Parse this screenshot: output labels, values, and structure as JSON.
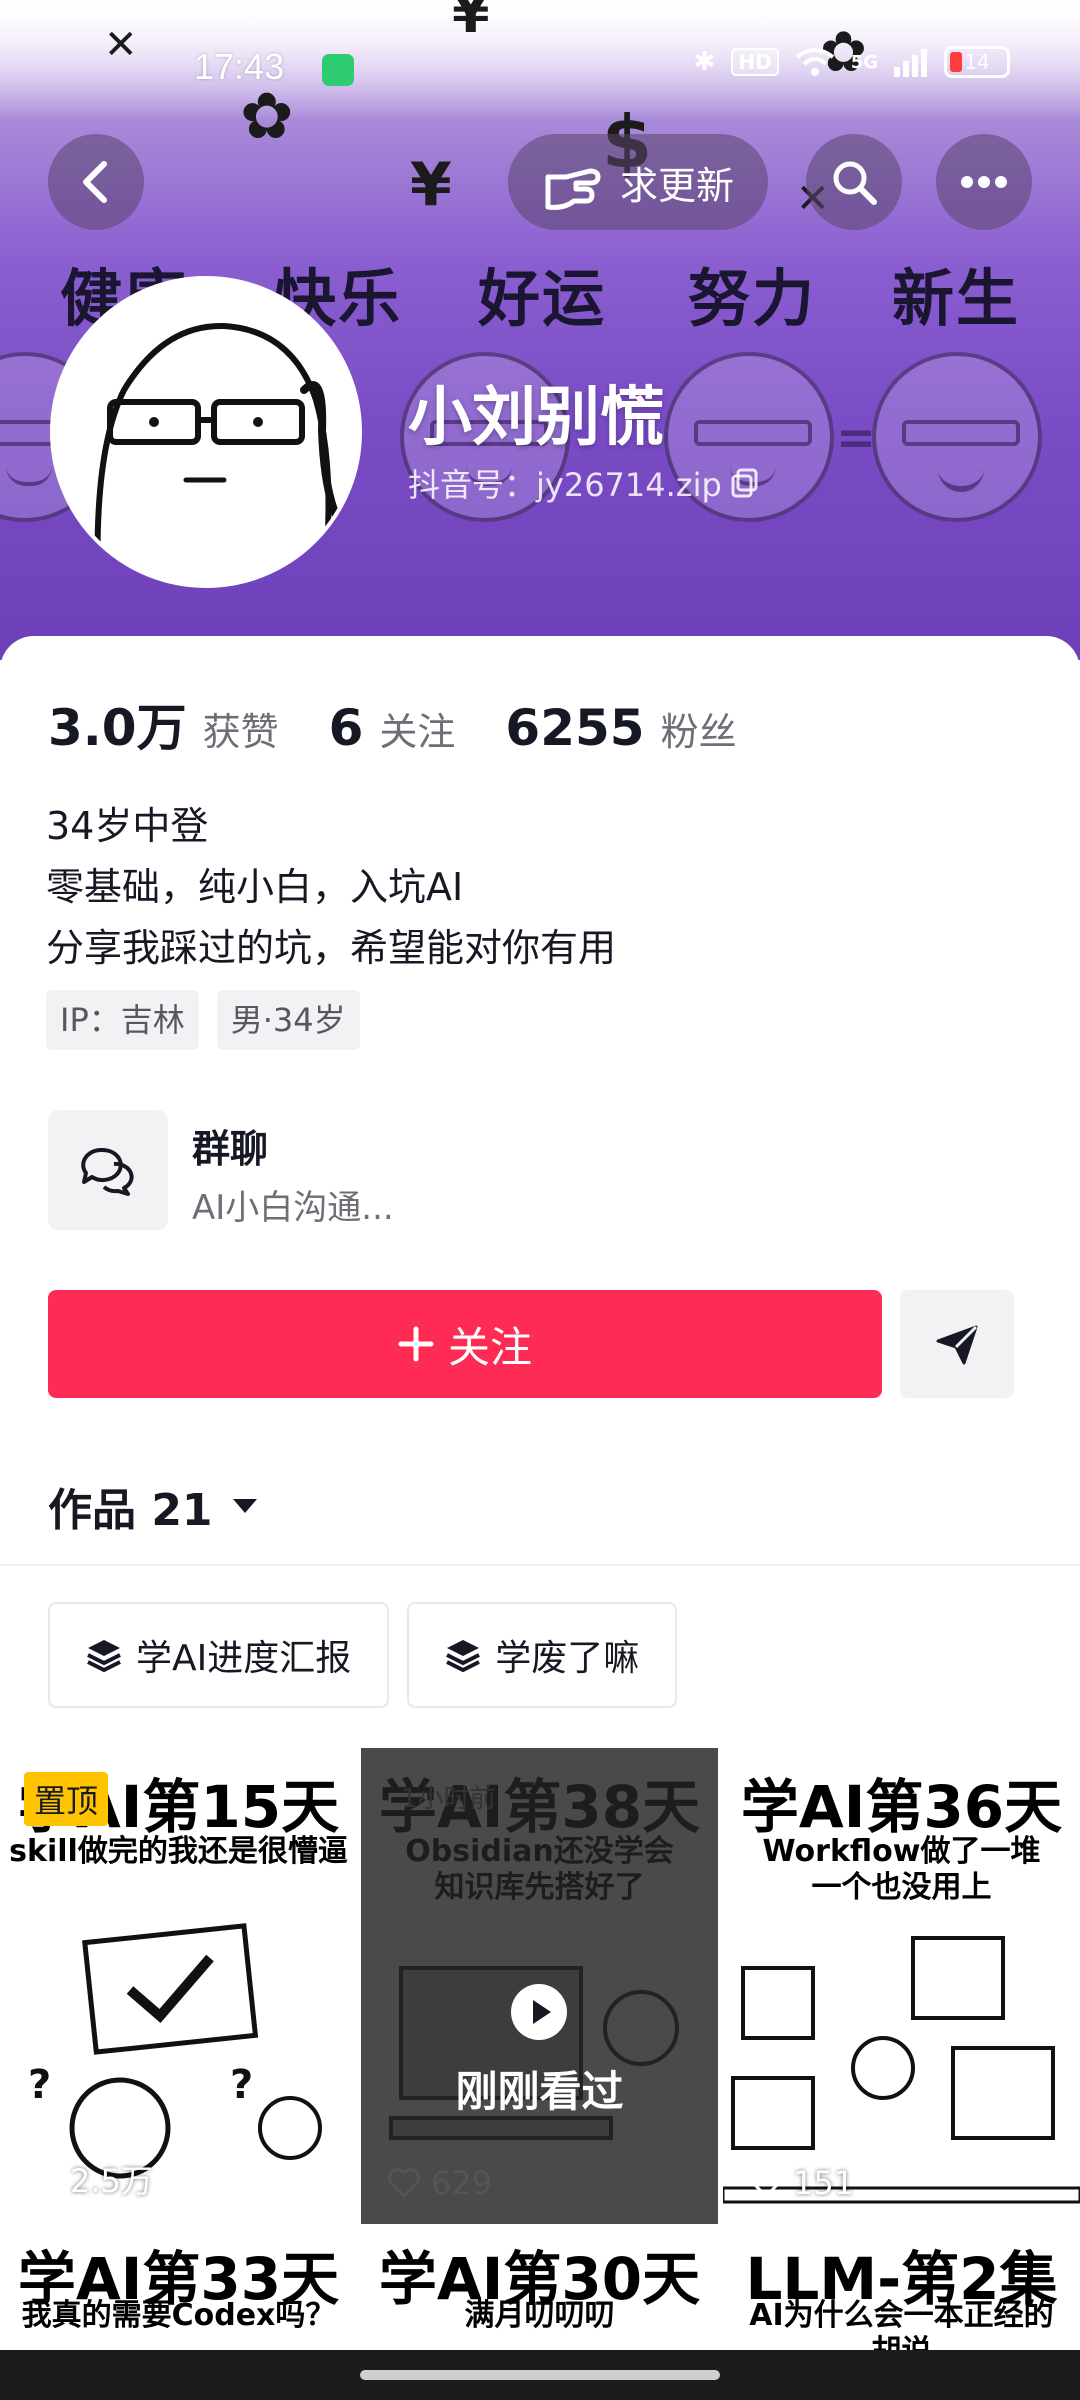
{
  "status_bar": {
    "time": "17:43",
    "network": "5G",
    "hd": "HD",
    "battery": "14"
  },
  "nav": {
    "update_label": "求更新"
  },
  "banner": {
    "words": [
      "健康",
      "快乐",
      "好运",
      "努力",
      "新生"
    ]
  },
  "profile": {
    "name": "小刘别慌",
    "handle": "抖音号：jy26714.zip"
  },
  "stats": [
    {
      "num": "3.0万",
      "label": "获赞"
    },
    {
      "num": "6",
      "label": "关注"
    },
    {
      "num": "6255",
      "label": "粉丝"
    }
  ],
  "bio": [
    "34岁中登",
    "零基础，纯小白，入坑AI",
    "分享我踩过的坑，希望能对你有用"
  ],
  "tags": [
    "IP：吉林",
    "男·34岁"
  ],
  "group_chat": {
    "title": "群聊",
    "subtitle": "AI小白沟通..."
  },
  "actions": {
    "follow_label": "关注"
  },
  "works": {
    "label": "作品 21"
  },
  "collections": [
    "学AI进度汇报",
    "学废了嘛"
  ],
  "videos": [
    {
      "title": "学AI第15天",
      "subtitle": "skill做完的我还是很懵逼",
      "likes": "2.5万",
      "pinned": "置顶"
    },
    {
      "title": "学AI第38天",
      "subtitle": "Obsidian还没学会\n知识库先搭好了",
      "likes": "629",
      "overlay": "刚刚看过",
      "badge": "1小时前"
    },
    {
      "title": "学AI第36天",
      "subtitle": "Workflow做了一堆\n一个也没用上",
      "likes": "151"
    },
    {
      "title": "学AI第33天",
      "subtitle": "我真的需要Codex吗？"
    },
    {
      "title": "学AI第30天",
      "subtitle": "满月叨叨叨"
    },
    {
      "title": "LLM-第2集",
      "subtitle": "AI为什么会一本正经的\n胡说"
    }
  ],
  "colors": {
    "accent": "#fe2c55",
    "pinned": "#ffc300",
    "banner": "#7a4cc6"
  }
}
